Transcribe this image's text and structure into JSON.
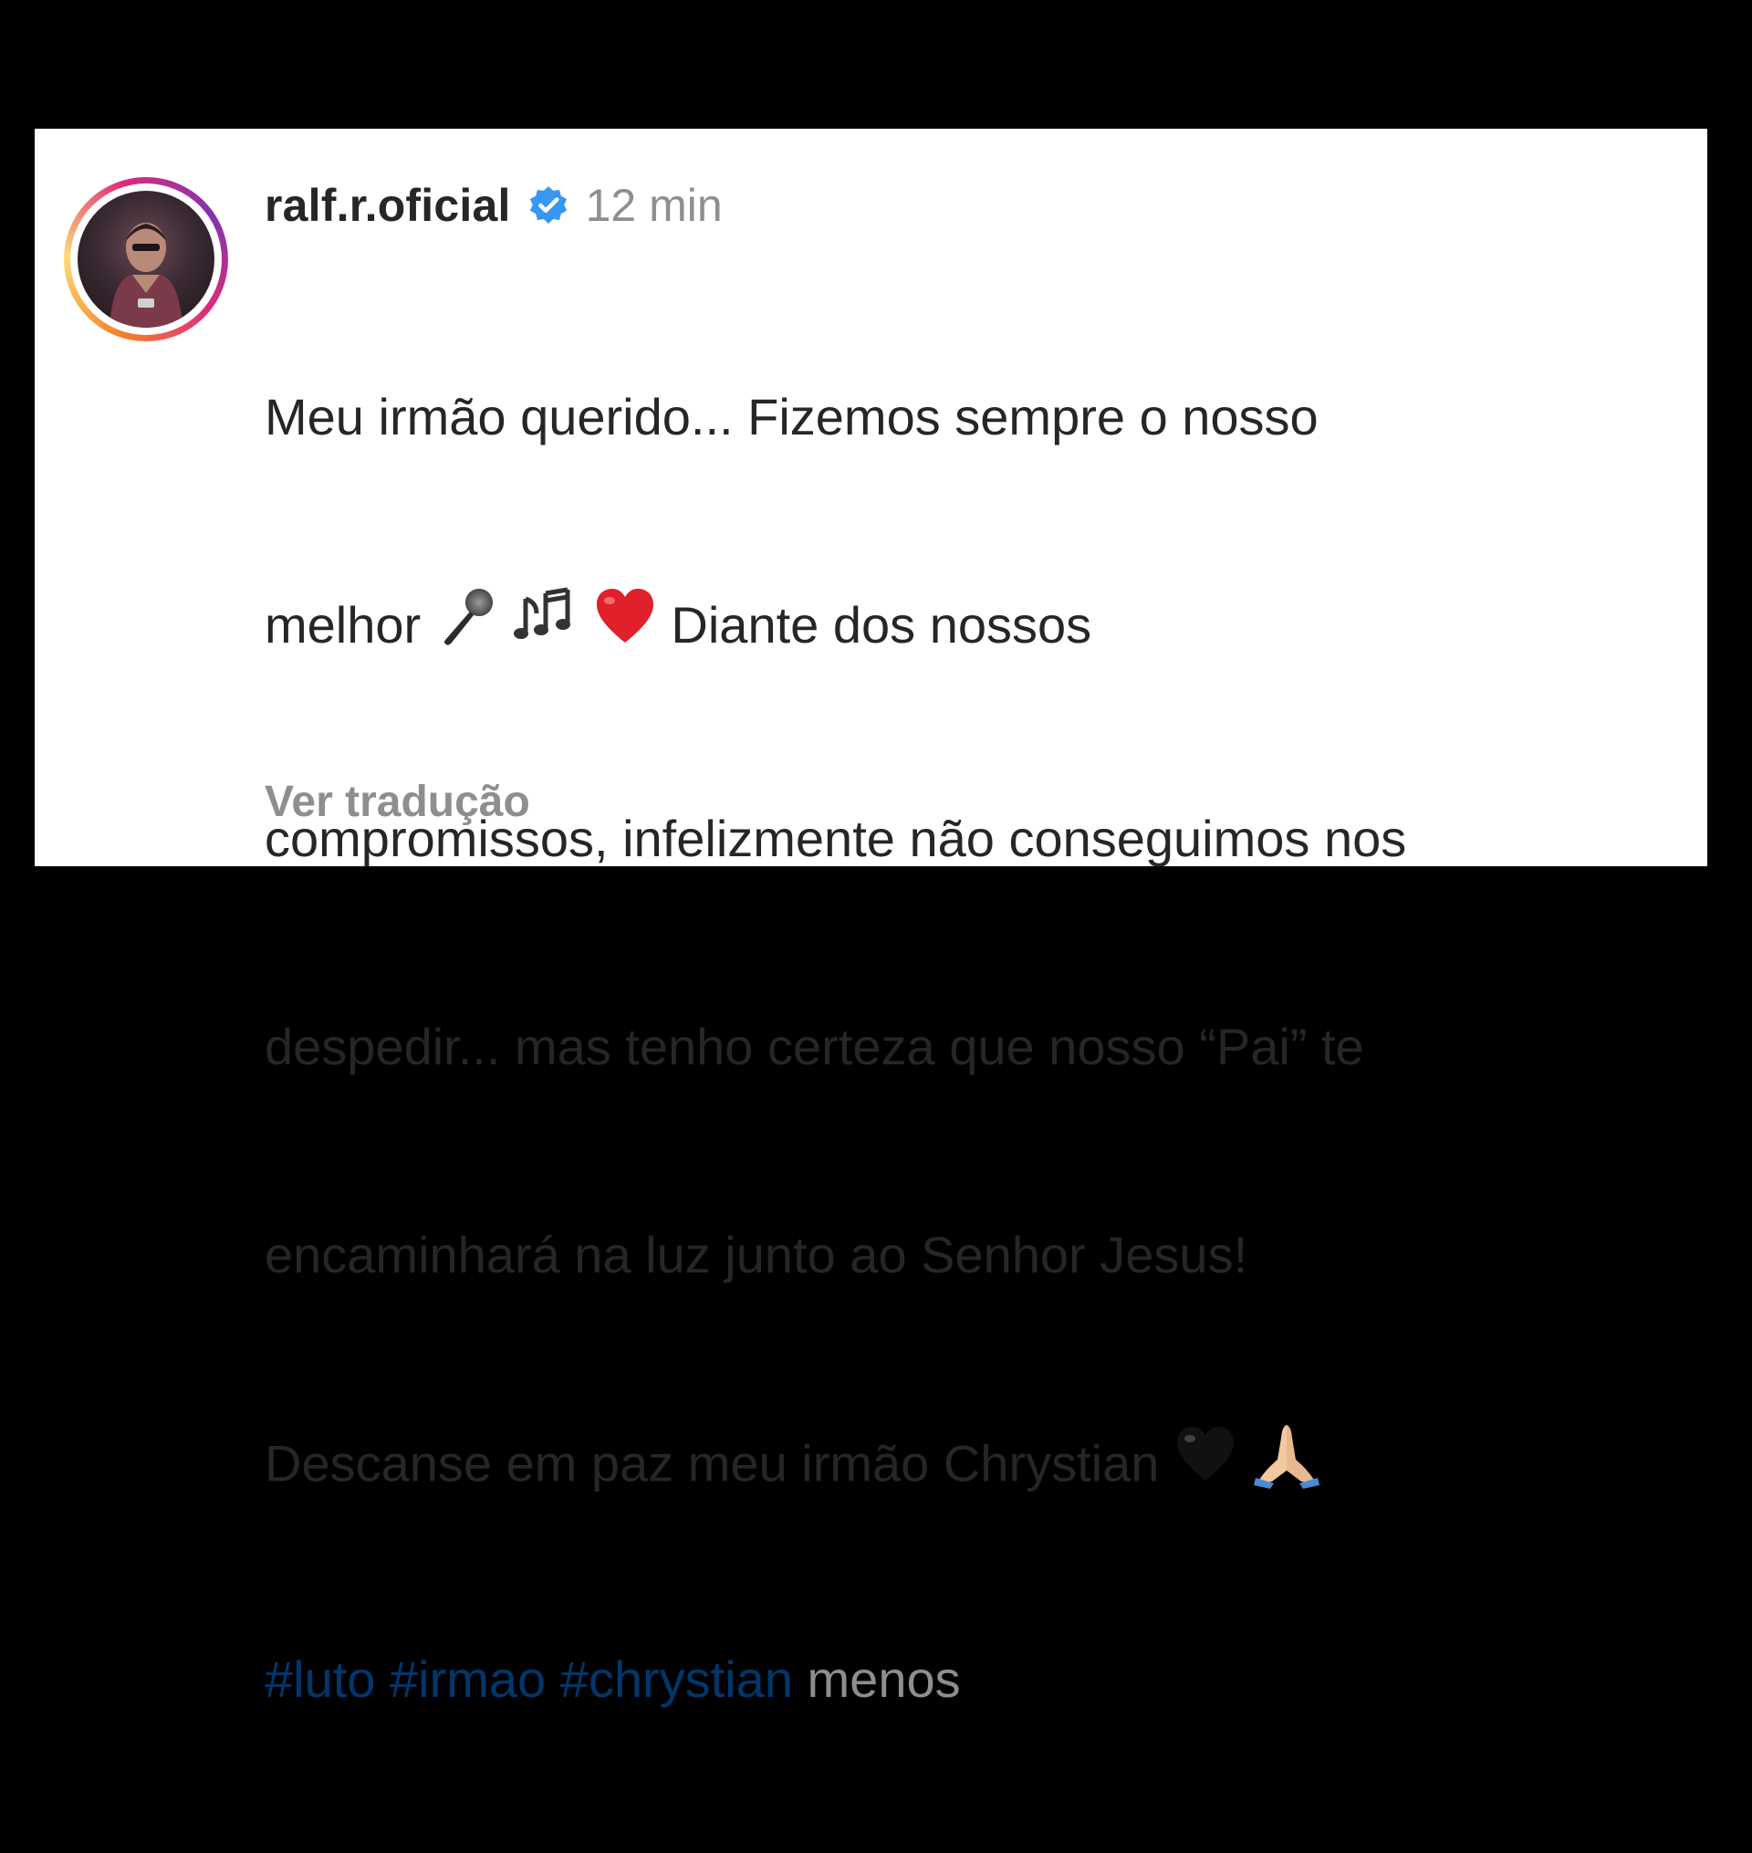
{
  "post": {
    "username": "ralf.r.oficial",
    "timestamp": "12 min",
    "caption_lines": [
      "Meu irmão querido... Fizemos sempre o nosso",
      "melhor",
      "Diante dos nossos",
      "compromissos, infelizmente não conseguimos nos",
      "despedir... mas tenho certeza que nosso “Pai” te",
      "encaminhará na luz junto ao Senhor Jesus!",
      "Descanse em paz meu irmão Chrystian"
    ],
    "hashtags": [
      "#luto",
      "#irmao",
      "#chrystian"
    ],
    "less_label": "menos",
    "translate_label": "Ver tradução"
  },
  "icons": {
    "verified": "verified-badge-icon",
    "microphone": "microphone-emoji",
    "music_notes": "music-notes-emoji",
    "red_heart": "red-heart-emoji",
    "black_heart": "black-heart-emoji",
    "praying_hands": "praying-hands-emoji"
  },
  "colors": {
    "background": "#000000",
    "card": "#ffffff",
    "text": "#262626",
    "muted": "#8e8e8e",
    "hashtag": "#00376b",
    "verified": "#3897f0"
  }
}
